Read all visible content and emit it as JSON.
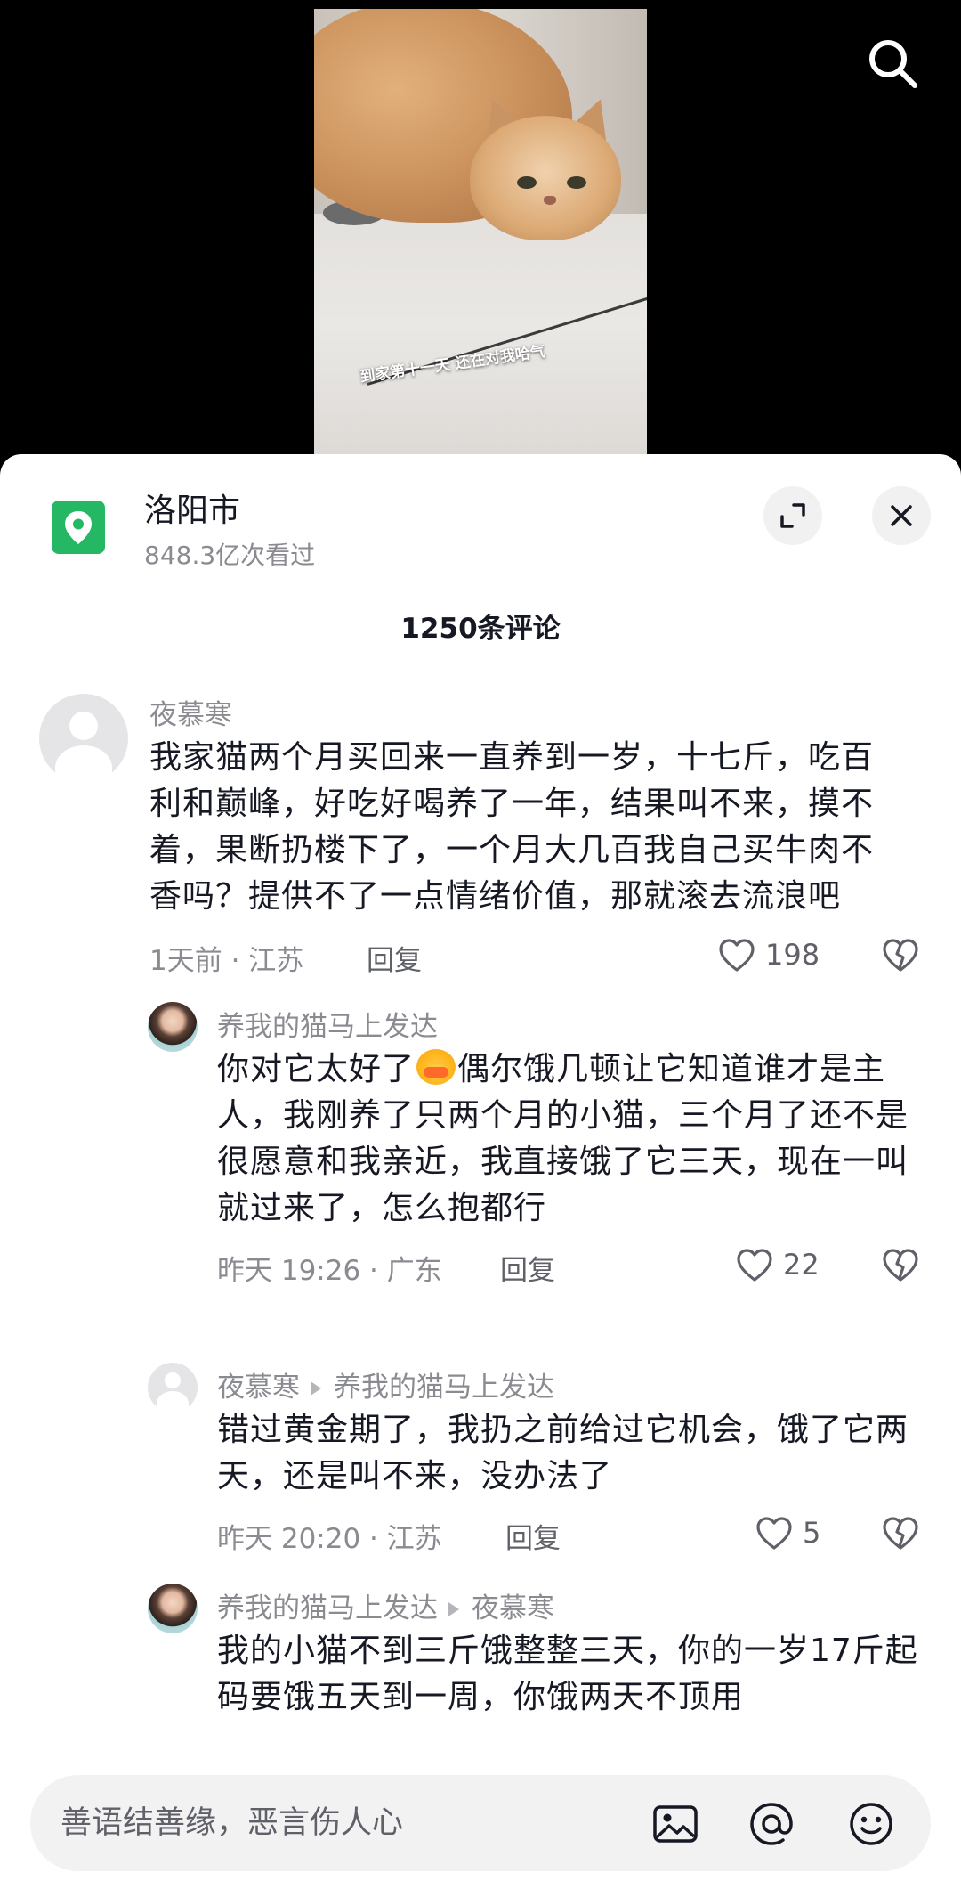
{
  "video": {
    "caption": "到家第十一天 还在对我哈气"
  },
  "icons": {
    "search": "search-icon",
    "location": "location-pin-icon",
    "expand": "expand-icon",
    "close": "close-icon",
    "like": "heart-icon",
    "dislike": "broken-heart-icon",
    "image": "image-icon",
    "mention": "at-icon",
    "emoji": "smiley-icon"
  },
  "colors": {
    "accent_green": "#25b864",
    "muted_text": "#8a8b91"
  },
  "location": {
    "name": "洛阳市",
    "views": "848.3亿次看过"
  },
  "comments_header": "1250条评论",
  "comments": [
    {
      "author": "夜慕寒",
      "text": "我家猫两个月买回来一直养到一岁，十七斤，吃百利和巅峰，好吃好喝养了一年，结果叫不来，摸不着，果断扔楼下了，一个月大几百我自己买牛肉不香吗？提供不了一点情绪价值，那就滚去流浪吧",
      "meta": "1天前 · 江苏",
      "reply_label": "回复",
      "likes": "198"
    },
    {
      "author": "养我的猫马上发达",
      "text_before_emoji": "你对它太好了",
      "text_after_emoji": "偶尔饿几顿让它知道谁才是主人，我刚养了只两个月的小猫，三个月了还不是很愿意和我亲近，我直接饿了它三天，现在一叫就过来了，怎么抱都行",
      "meta": "昨天 19:26 · 广东",
      "reply_label": "回复",
      "likes": "22"
    },
    {
      "author": "夜慕寒",
      "reply_to": "养我的猫马上发达",
      "text": "错过黄金期了，我扔之前给过它机会，饿了它两天，还是叫不来，没办法了",
      "meta": "昨天 20:20 · 江苏",
      "reply_label": "回复",
      "likes": "5"
    },
    {
      "author": "养我的猫马上发达",
      "reply_to": "夜慕寒",
      "text": "我的小猫不到三斤饿整整三天，你的一岁17斤起码要饿五天到一周，你饿两天不顶用"
    }
  ],
  "input": {
    "placeholder": "善语结善缘，恶言伤人心"
  }
}
